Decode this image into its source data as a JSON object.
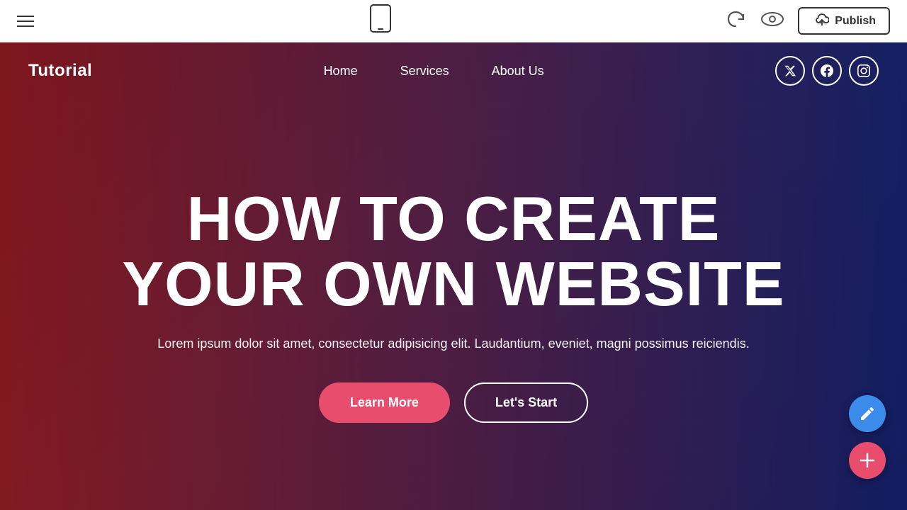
{
  "toolbar": {
    "hamburger_label": "menu",
    "phone_preview_label": "mobile preview",
    "undo_label": "undo",
    "eye_label": "preview",
    "publish_label": "Publish",
    "cloud_label": "cloud upload"
  },
  "site": {
    "logo": "Tutorial",
    "nav": {
      "links": [
        {
          "label": "Home",
          "id": "home"
        },
        {
          "label": "Services",
          "id": "services"
        },
        {
          "label": "About Us",
          "id": "about"
        }
      ],
      "socials": [
        {
          "icon": "twitter",
          "symbol": "𝕏"
        },
        {
          "icon": "facebook",
          "symbol": "f"
        },
        {
          "icon": "instagram",
          "symbol": "📷"
        }
      ]
    }
  },
  "hero": {
    "title_line1": "HOW TO CREATE",
    "title_line2": "YOUR OWN WEBSITE",
    "subtitle": "Lorem ipsum dolor sit amet, consectetur adipisicing elit. Laudantium, eveniet, magni possimus reiciendis.",
    "btn_learn_more": "Learn More",
    "btn_lets_start": "Let's Start"
  },
  "colors": {
    "accent_pink": "#e84d6e",
    "accent_blue": "#3b8beb",
    "overlay_left": "rgba(160,20,30,0.75)",
    "overlay_right": "rgba(15,30,120,0.75)"
  }
}
